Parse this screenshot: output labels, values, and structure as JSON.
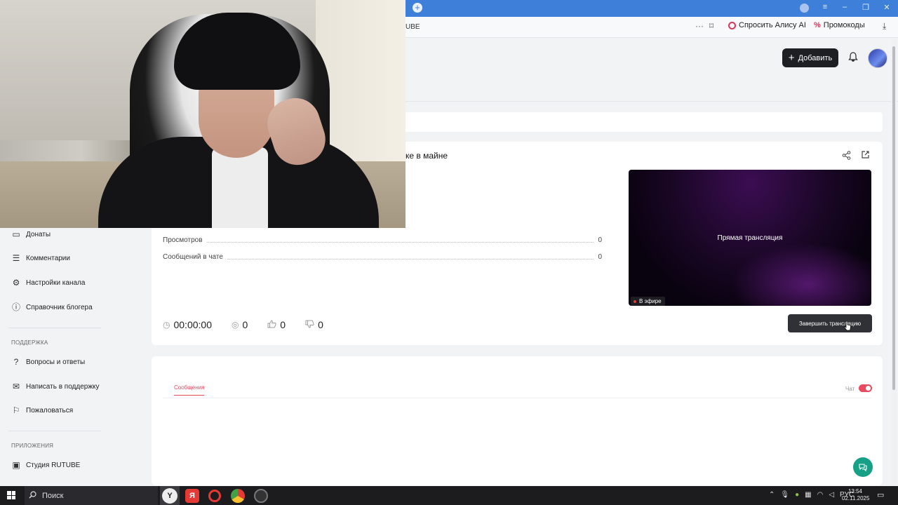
{
  "browser": {
    "url_fragment": "UBE",
    "menu_dots": "···",
    "alisa_label": "Спросить Алису AI",
    "promo_label": "Промокоды"
  },
  "header": {
    "add_label": "Добавить"
  },
  "stream": {
    "title_fragment": "ке в майне",
    "stats": [
      {
        "label": "Просмотров",
        "value": "0"
      },
      {
        "label": "Сообщений в чате",
        "value": "0"
      }
    ],
    "player_title": "Прямая трансляция",
    "live_badge": "В эфире",
    "end_button": "Завершить трансляцию",
    "duration": "00:00:00",
    "viewers": "0",
    "likes": "0",
    "dislikes": "0"
  },
  "chat": {
    "tab_messages": "Сообщения",
    "chat_label": "Чат",
    "chat_enabled": true
  },
  "sidebar": {
    "items_top": [
      {
        "label": "Донаты",
        "icon": "wallet-icon"
      },
      {
        "label": "Комментарии",
        "icon": "comments-icon"
      },
      {
        "label": "Настройки канала",
        "icon": "gear-icon"
      },
      {
        "label": "Справочник блогера",
        "icon": "info-icon"
      }
    ],
    "support_section": "ПОДДЕРЖКА",
    "items_support": [
      {
        "label": "Вопросы и ответы",
        "icon": "question-icon"
      },
      {
        "label": "Написать в поддержку",
        "icon": "mail-icon"
      },
      {
        "label": "Пожаловаться",
        "icon": "flag-icon"
      }
    ],
    "apps_section": "ПРИЛОЖЕНИЯ",
    "items_apps": [
      {
        "label": "Студия RUTUBE",
        "icon": "studio-icon"
      }
    ]
  },
  "taskbar": {
    "search_placeholder": "Поиск",
    "lang": "РУС",
    "time": "13:54",
    "date": "02.11.2025"
  },
  "colors": {
    "accent": "#e84a5f",
    "live_dot": "#e53935",
    "browser_bar": "#3d7fd9"
  }
}
